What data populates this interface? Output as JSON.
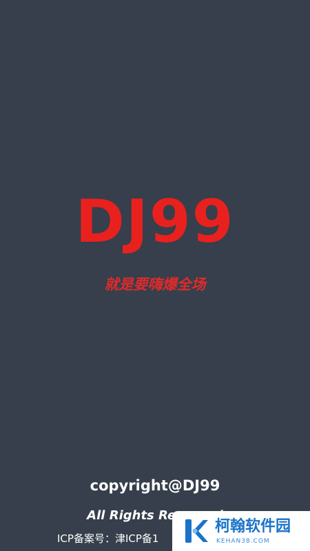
{
  "splash": {
    "brand": "DJ99",
    "slogan": "就是要嗨爆全场"
  },
  "footer": {
    "copyright": "copyright@DJ99",
    "rights": "All Rights Reserved",
    "icp": "ICP备案号：津ICP备1"
  },
  "watermark": {
    "name": "柯翰软件园",
    "domain": "KEHAN38.COM",
    "logo_icon": "k-logo-icon"
  },
  "colors": {
    "background": "#363f4b",
    "brand": "#e8211f",
    "slogan": "#e02a2a",
    "footer_text": "#ffffff",
    "watermark_accent": "#1a73c8"
  }
}
